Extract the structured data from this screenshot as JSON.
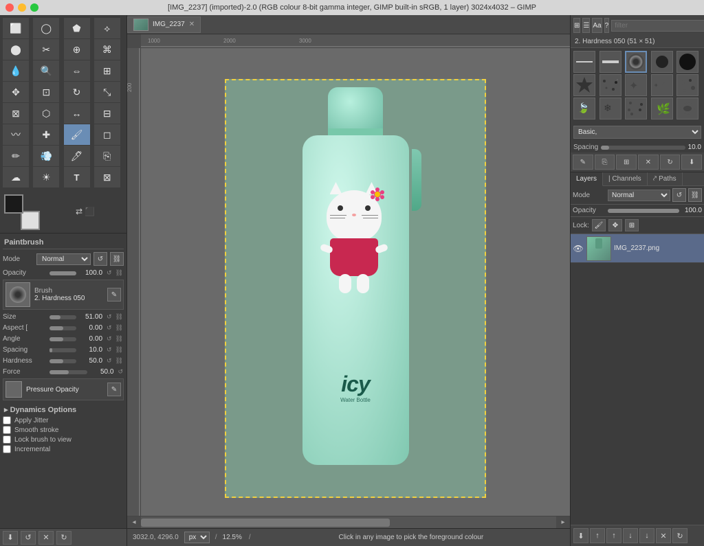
{
  "titlebar": {
    "title": "[IMG_2237] (imported)-2.0 (RGB colour 8-bit gamma integer, GIMP built-in sRGB, 1 layer) 3024x4032 – GIMP"
  },
  "toolbox": {
    "tools": [
      {
        "name": "rectangle-select",
        "icon": "⬜"
      },
      {
        "name": "ellipse-select",
        "icon": "⭕"
      },
      {
        "name": "free-select",
        "icon": "🔗"
      },
      {
        "name": "fuzzy-select",
        "icon": "🪄"
      },
      {
        "name": "color-select",
        "icon": "🎨"
      },
      {
        "name": "scissors",
        "icon": "✂"
      },
      {
        "name": "foreground-select",
        "icon": "🔧"
      },
      {
        "name": "paths",
        "icon": "✏"
      },
      {
        "name": "color-picker",
        "icon": "💧"
      },
      {
        "name": "zoom",
        "icon": "🔍"
      },
      {
        "name": "measure",
        "icon": "📏"
      },
      {
        "name": "align",
        "icon": "⬛"
      },
      {
        "name": "move",
        "icon": "✥"
      },
      {
        "name": "crop",
        "icon": "⊡"
      },
      {
        "name": "rotate",
        "icon": "↻"
      },
      {
        "name": "scale",
        "icon": "⤡"
      },
      {
        "name": "shear",
        "icon": "⊠"
      },
      {
        "name": "perspective",
        "icon": "⬡"
      },
      {
        "name": "flip",
        "icon": "↔"
      },
      {
        "name": "cage",
        "icon": "⊞"
      },
      {
        "name": "warp",
        "icon": "〰"
      },
      {
        "name": "heal",
        "icon": "✚"
      },
      {
        "name": "paintbrush",
        "icon": "🖌",
        "active": true
      },
      {
        "name": "eraser",
        "icon": "◻"
      },
      {
        "name": "pencil",
        "icon": "✏"
      },
      {
        "name": "airbrush",
        "icon": "💨"
      },
      {
        "name": "ink",
        "icon": "🖊"
      },
      {
        "name": "clone",
        "icon": "⎘"
      },
      {
        "name": "smudge",
        "icon": "☁"
      },
      {
        "name": "dodge",
        "icon": "☀"
      },
      {
        "name": "text",
        "icon": "T"
      },
      {
        "name": "bucket",
        "icon": "🪣"
      }
    ]
  },
  "tool_options": {
    "section_title": "Paintbrush",
    "mode_label": "Mode",
    "mode_value": "Normal",
    "opacity_label": "Opacity",
    "opacity_value": "100.0",
    "brush_label": "Brush",
    "brush_name": "2. Hardness 050",
    "size_label": "Size",
    "size_value": "51.00",
    "aspect_label": "Aspect [",
    "aspect_value": "0.00",
    "angle_label": "Angle",
    "angle_value": "0.00",
    "spacing_label": "Spacing",
    "spacing_value": "10.0",
    "hardness_label": "Hardness",
    "hardness_value": "50.0",
    "force_label": "Force",
    "force_value": "50.0",
    "dynamics_label": "Dynamics",
    "dynamics_name": "Pressure Opacity",
    "dynamics_options_label": "Dynamics Options",
    "apply_jitter_label": "Apply Jitter",
    "smooth_stroke_label": "Smooth stroke",
    "lock_brush_label": "Lock brush to view",
    "incremental_label": "Incremental"
  },
  "canvas": {
    "coords": "3032.0, 4296.0",
    "unit": "px",
    "zoom": "12.5%",
    "status_msg": "Click in any image to pick the foreground colour"
  },
  "right_panel": {
    "filter_placeholder": "filter",
    "selected_brush": "2. Hardness 050 (51 × 51)",
    "preset_options": [
      "Basic,"
    ],
    "preset_selected": "Basic,",
    "spacing_label": "Spacing",
    "spacing_value": "10.0",
    "brush_cells": [
      {
        "type": "line",
        "label": "line-brush"
      },
      {
        "type": "line2",
        "label": "line2-brush"
      },
      {
        "type": "circle-soft",
        "label": "hardness-050",
        "selected": true
      },
      {
        "type": "circle-hard",
        "label": "hardness-100"
      },
      {
        "type": "circle-black",
        "label": "full-circle"
      },
      {
        "type": "star",
        "label": "star-brush"
      },
      {
        "type": "dots",
        "label": "star2-brush"
      },
      {
        "type": "scatter1",
        "label": "scatter1"
      },
      {
        "type": "scatter2",
        "label": "scatter2"
      },
      {
        "type": "scatter3",
        "label": "scatter3"
      },
      {
        "type": "texture1",
        "label": "texture1"
      },
      {
        "type": "texture2",
        "label": "texture2"
      },
      {
        "type": "texture3",
        "label": "texture3"
      },
      {
        "type": "texture4",
        "label": "texture4"
      },
      {
        "type": "texture5",
        "label": "texture5"
      }
    ]
  },
  "layers_panel": {
    "tabs": [
      {
        "name": "layers-tab",
        "label": "Layers",
        "active": true
      },
      {
        "name": "channels-tab",
        "label": "Channels"
      },
      {
        "name": "paths-tab",
        "label": "Paths"
      }
    ],
    "mode_label": "Mode",
    "mode_value": "Normal",
    "opacity_label": "Opacity",
    "opacity_value": "100.0",
    "lock_label": "Lock:",
    "layers": [
      {
        "name": "IMG_2237.png",
        "visible": true,
        "selected": true
      }
    ]
  },
  "bottom_toolbar": {
    "buttons": [
      "⬇",
      "↺",
      "✕",
      "↻"
    ]
  },
  "right_bottom_toolbar": {
    "buttons": [
      "⬇",
      "↑",
      "↑",
      "↓",
      "↓",
      "✕",
      "↻"
    ]
  }
}
